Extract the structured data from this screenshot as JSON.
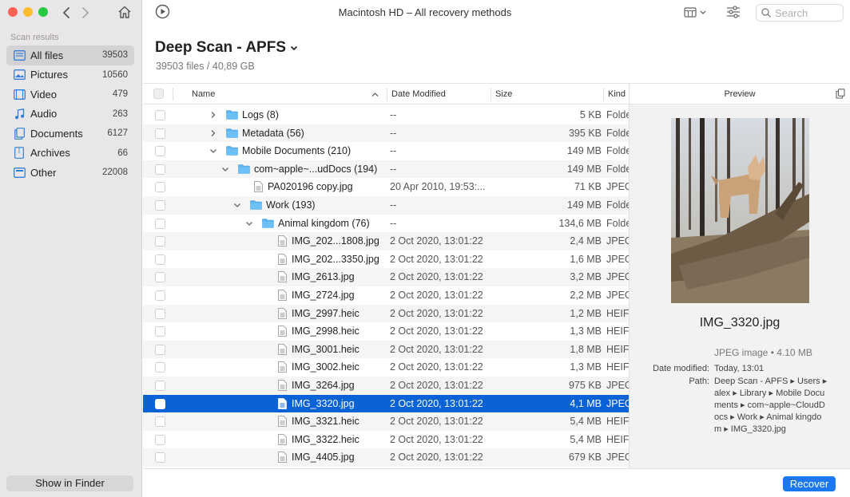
{
  "window": {
    "title": "Macintosh HD – All recovery methods"
  },
  "search": {
    "placeholder": "Search"
  },
  "sidebar": {
    "heading": "Scan results",
    "items": [
      {
        "label": "All files",
        "count": "39503",
        "icon": "all-files-icon"
      },
      {
        "label": "Pictures",
        "count": "10560",
        "icon": "pictures-icon"
      },
      {
        "label": "Video",
        "count": "479",
        "icon": "video-icon"
      },
      {
        "label": "Audio",
        "count": "263",
        "icon": "audio-icon"
      },
      {
        "label": "Documents",
        "count": "6127",
        "icon": "documents-icon"
      },
      {
        "label": "Archives",
        "count": "66",
        "icon": "archives-icon"
      },
      {
        "label": "Other",
        "count": "22008",
        "icon": "other-icon"
      }
    ],
    "show_in_finder": "Show in Finder"
  },
  "heading": {
    "title": "Deep Scan - APFS",
    "subtitle": "39503 files / 40,89 GB"
  },
  "table": {
    "columns": {
      "name": "Name",
      "date": "Date Modified",
      "size": "Size",
      "kind": "Kind"
    },
    "rows": [
      {
        "name": "Logs (8)",
        "date": "--",
        "size": "5 KB",
        "kind": "Folde",
        "type": "folder",
        "level": 0,
        "chevron": "collapsed"
      },
      {
        "name": "Metadata (56)",
        "date": "--",
        "size": "395 KB",
        "kind": "Folde",
        "type": "folder",
        "level": 0,
        "chevron": "collapsed"
      },
      {
        "name": "Mobile Documents (210)",
        "date": "--",
        "size": "149 MB",
        "kind": "Folde",
        "type": "folder",
        "level": 0,
        "chevron": "expanded"
      },
      {
        "name": "com~apple~...udDocs (194)",
        "date": "--",
        "size": "149 MB",
        "kind": "Folde",
        "type": "folder",
        "level": 1,
        "chevron": "expanded"
      },
      {
        "name": "PA020196 copy.jpg",
        "date": "20 Apr 2010, 19:53:...",
        "size": "71 KB",
        "kind": "JPEG",
        "type": "file",
        "level": 2,
        "chevron": "none"
      },
      {
        "name": "Work (193)",
        "date": "--",
        "size": "149 MB",
        "kind": "Folde",
        "type": "folder",
        "level": 2,
        "chevron": "expanded"
      },
      {
        "name": "Animal kingdom (76)",
        "date": "--",
        "size": "134,6 MB",
        "kind": "Folde",
        "type": "folder",
        "level": 3,
        "chevron": "expanded"
      },
      {
        "name": "IMG_202...1808.jpg",
        "date": "2 Oct 2020, 13:01:22",
        "size": "2,4 MB",
        "kind": "JPEG",
        "type": "file",
        "level": 4,
        "chevron": "none"
      },
      {
        "name": "IMG_202...3350.jpg",
        "date": "2 Oct 2020, 13:01:22",
        "size": "1,6 MB",
        "kind": "JPEG",
        "type": "file",
        "level": 4,
        "chevron": "none"
      },
      {
        "name": "IMG_2613.jpg",
        "date": "2 Oct 2020, 13:01:22",
        "size": "3,2 MB",
        "kind": "JPEG",
        "type": "file",
        "level": 4,
        "chevron": "none"
      },
      {
        "name": "IMG_2724.jpg",
        "date": "2 Oct 2020, 13:01:22",
        "size": "2,2 MB",
        "kind": "JPEG",
        "type": "file",
        "level": 4,
        "chevron": "none"
      },
      {
        "name": "IMG_2997.heic",
        "date": "2 Oct 2020, 13:01:22",
        "size": "1,2 MB",
        "kind": "HEIF",
        "type": "file",
        "level": 4,
        "chevron": "none"
      },
      {
        "name": "IMG_2998.heic",
        "date": "2 Oct 2020, 13:01:22",
        "size": "1,3 MB",
        "kind": "HEIF",
        "type": "file",
        "level": 4,
        "chevron": "none"
      },
      {
        "name": "IMG_3001.heic",
        "date": "2 Oct 2020, 13:01:22",
        "size": "1,8 MB",
        "kind": "HEIF",
        "type": "file",
        "level": 4,
        "chevron": "none"
      },
      {
        "name": "IMG_3002.heic",
        "date": "2 Oct 2020, 13:01:22",
        "size": "1,3 MB",
        "kind": "HEIF",
        "type": "file",
        "level": 4,
        "chevron": "none"
      },
      {
        "name": "IMG_3264.jpg",
        "date": "2 Oct 2020, 13:01:22",
        "size": "975 KB",
        "kind": "JPEG",
        "type": "file",
        "level": 4,
        "chevron": "none"
      },
      {
        "name": "IMG_3320.jpg",
        "date": "2 Oct 2020, 13:01:22",
        "size": "4,1 MB",
        "kind": "JPEG",
        "type": "file",
        "level": 4,
        "chevron": "none",
        "selected": true
      },
      {
        "name": "IMG_3321.heic",
        "date": "2 Oct 2020, 13:01:22",
        "size": "5,4 MB",
        "kind": "HEIF",
        "type": "file",
        "level": 4,
        "chevron": "none"
      },
      {
        "name": "IMG_3322.heic",
        "date": "2 Oct 2020, 13:01:22",
        "size": "5,4 MB",
        "kind": "HEIF",
        "type": "file",
        "level": 4,
        "chevron": "none"
      },
      {
        "name": "IMG_4405.jpg",
        "date": "2 Oct 2020, 13:01:22",
        "size": "679 KB",
        "kind": "JPEG",
        "type": "file",
        "level": 4,
        "chevron": "none"
      }
    ]
  },
  "preview": {
    "header": "Preview",
    "filename": "IMG_3320.jpg",
    "kind": "JPEG image • 4.10 MB",
    "date_label": "Date modified:",
    "date_value": "Today, 13:01",
    "path_label": "Path:",
    "path_lines": [
      "Deep Scan - APFS ▸ Users ▸",
      "alex ▸ Library ▸ Mobile Docu",
      "ments ▸ com~apple~CloudD",
      "ocs ▸ Work ▸ Animal kingdo",
      "m ▸ IMG_3320.jpg"
    ]
  },
  "footer": {
    "recover": "Recover"
  },
  "colors": {
    "accent": "#1b78ef",
    "selection": "#0a63d6",
    "folder": "#5fb4f0"
  }
}
